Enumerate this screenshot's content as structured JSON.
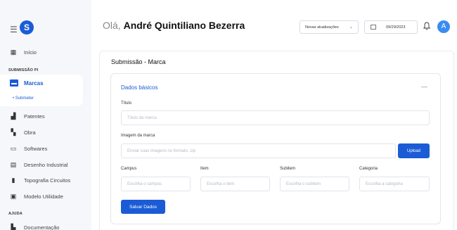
{
  "sidebar": {
    "logo_letter": "S",
    "inicio": "Início",
    "section_submissao": "SUBMISSÃO PI",
    "marcas": "Marcas",
    "submeter": "Submeter",
    "patentes": "Patentes",
    "obra": "Obra",
    "softwares": "Softwares",
    "desenho": "Desenho Industrial",
    "topografia": "Topografia Circuitos",
    "modelo": "Modelo Utilidade",
    "section_ajuda": "AJUDA",
    "documentacao": "Documentação"
  },
  "header": {
    "greeting": "Olá,",
    "user_name": "André Quintiliano Bezerra",
    "updates_select": "Novas atualizações",
    "date": "09/29/2023",
    "avatar_letter": "A"
  },
  "page": {
    "title": "Submissão - Marca",
    "card_title": "Dados básicos",
    "collapse_symbol": "—"
  },
  "form": {
    "titulo_label": "Título",
    "titulo_placeholder": "Título da marca",
    "imagem_label": "Imagem da marca",
    "imagem_placeholder": "Enviar suas imagens no formato .zip",
    "upload_button": "Upload",
    "campus_label": "Campus",
    "campus_placeholder": "Escolha o campus",
    "item_label": "Item",
    "item_placeholder": "Escolha o item",
    "subitem_label": "Subitem",
    "subitem_placeholder": "Escolha o subitem",
    "categoria_label": "Categoria",
    "categoria_placeholder": "Escolha a categoria",
    "save_button": "Salvar Dados"
  },
  "colors": {
    "primary": "#1b5cd6",
    "sidebar_bg": "#f6f7fb",
    "avatar": "#3b8cf2"
  }
}
